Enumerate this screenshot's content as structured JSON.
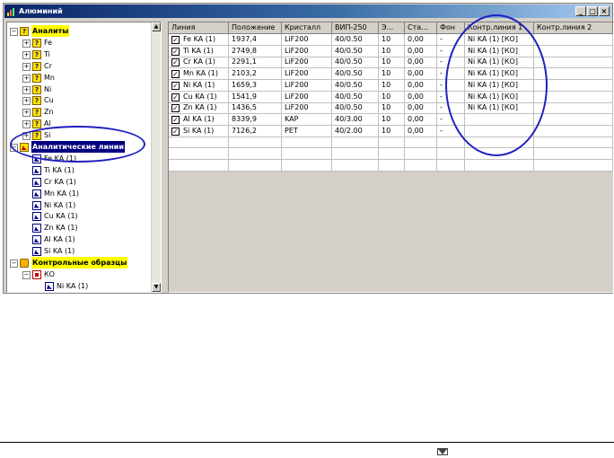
{
  "window": {
    "title": "Алюминий",
    "minimize": "_",
    "maximize": "□",
    "close": "×"
  },
  "tree": {
    "analytes_label": "Аналиты",
    "analytes": [
      "Fe",
      "Ti",
      "Cr",
      "Mn",
      "Ni",
      "Cu",
      "Zn",
      "Al",
      "Si"
    ],
    "lines_label": "Аналитические линии",
    "lines": [
      "Fe KA (1)",
      "Ti KA (1)",
      "Cr KA (1)",
      "Mn KA (1)",
      "Ni KA (1)",
      "Cu KA (1)",
      "Zn KA (1)",
      "Al KA (1)",
      "Si KA (1)"
    ],
    "controls_label": "Контрольные образцы",
    "control_sample": "КО",
    "control_line": "Ni KA (1)",
    "expand_minus": "−",
    "expand_plus": "+"
  },
  "table": {
    "columns": [
      "Линия",
      "Положение",
      "Кристалл",
      "ВИП-250",
      "Э...",
      "Ста...",
      "Фон",
      "Контр.линия 1",
      "Контр.линия 2"
    ],
    "rows": [
      [
        "Fe KA (1)",
        "1937,4",
        "LiF200",
        "40/0.50",
        "10",
        "0,00",
        "-",
        "Ni KA (1) [КО]",
        ""
      ],
      [
        "Ti KA (1)",
        "2749,8",
        "LiF200",
        "40/0.50",
        "10",
        "0,00",
        "-",
        "Ni KA (1) [КО]",
        ""
      ],
      [
        "Cr KA (1)",
        "2291,1",
        "LiF200",
        "40/0.50",
        "10",
        "0,00",
        "-",
        "Ni KA (1) [КО]",
        ""
      ],
      [
        "Mn KA (1)",
        "2103,2",
        "LiF200",
        "40/0.50",
        "10",
        "0,00",
        "-",
        "Ni KA (1) [КО]",
        ""
      ],
      [
        "Ni KA (1)",
        "1659,3",
        "LiF200",
        "40/0.50",
        "10",
        "0,00",
        "-",
        "Ni KA (1) [КО]",
        ""
      ],
      [
        "Cu KA (1)",
        "1541,9",
        "LiF200",
        "40/0.50",
        "10",
        "0,00",
        "-",
        "Ni KA (1) [КО]",
        ""
      ],
      [
        "Zn KA (1)",
        "1436,5",
        "LiF200",
        "40/0.50",
        "10",
        "0,00",
        "-",
        "Ni KA (1) [КО]",
        ""
      ],
      [
        "Al KA (1)",
        "8339,9",
        "KAP",
        "40/3.00",
        "10",
        "0,00",
        "-",
        "",
        ""
      ],
      [
        "Si KA (1)",
        "7126,2",
        "PET",
        "40/2.00",
        "10",
        "0,00",
        "-",
        "",
        ""
      ]
    ],
    "checked": [
      true,
      true,
      true,
      true,
      true,
      true,
      true,
      true,
      true
    ]
  },
  "colors": {
    "annotation": "#2020c0",
    "highlight": "#ffff00",
    "selection": "#000080"
  }
}
